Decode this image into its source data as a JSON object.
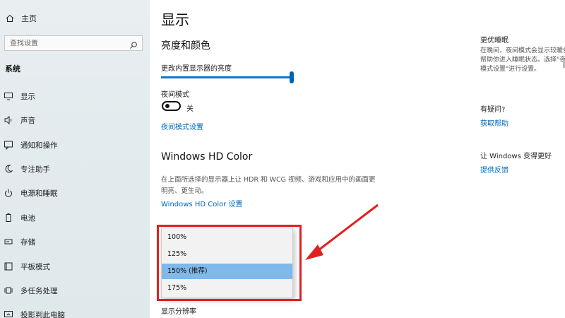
{
  "sidebar": {
    "home_label": "主页",
    "search_placeholder": "查找设置",
    "section_label": "系统",
    "items": [
      {
        "label": "显示",
        "icon": "monitor-icon"
      },
      {
        "label": "声音",
        "icon": "speaker-icon"
      },
      {
        "label": "通知和操作",
        "icon": "notification-icon"
      },
      {
        "label": "专注助手",
        "icon": "moon-icon"
      },
      {
        "label": "电源和睡眠",
        "icon": "power-icon"
      },
      {
        "label": "电池",
        "icon": "battery-icon"
      },
      {
        "label": "存储",
        "icon": "storage-icon"
      },
      {
        "label": "平板模式",
        "icon": "tablet-icon"
      },
      {
        "label": "多任务处理",
        "icon": "multitask-icon"
      },
      {
        "label": "投影到此电脑",
        "icon": "project-icon"
      }
    ]
  },
  "main": {
    "page_title": "显示",
    "brightness_section": "亮度和颜色",
    "brightness_label": "更改内置显示器的亮度",
    "brightness_level": 1.0,
    "night_mode_label": "夜间模式",
    "night_mode_state": "关",
    "night_mode_link": "夜间模式设置",
    "hd_title": "Windows HD Color",
    "hd_desc": "在上面所选择的显示器上让 HDR 和 WCG 视频、游戏和应用中的画面更明亮、更生动。",
    "hd_link": "Windows HD Color 设置",
    "scale_options": [
      "100%",
      "125%",
      "150% (推荐)",
      "175%"
    ],
    "scale_selected_index": 2,
    "resolution_label": "显示分辨率"
  },
  "right_panel": {
    "sleep_title": "更优睡眠",
    "sleep_text": "在晚间，夜间模式会显示较暖色，帮助你进入睡眠状态。选择\"夜间模式设置\"进行设置。",
    "question_title": "有疑问?",
    "help_link": "获取帮助",
    "improve_title": "让 Windows 变得更好",
    "feedback_link": "提供反馈"
  },
  "colors": {
    "accent": "#0078d7",
    "link": "#0067b8",
    "highlight_red": "#e02020",
    "selected_option": "#7fb8ea"
  }
}
